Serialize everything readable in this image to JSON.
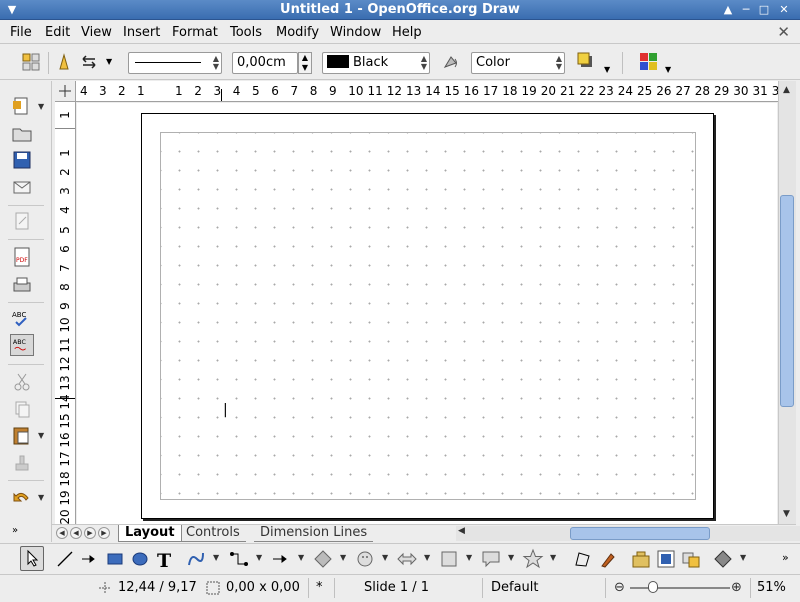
{
  "window": {
    "title": "Untitled 1 - OpenOffice.org Draw"
  },
  "menu": {
    "file": "File",
    "edit": "Edit",
    "view": "View",
    "insert": "Insert",
    "format": "Format",
    "tools": "Tools",
    "modify": "Modify",
    "window": "Window",
    "help": "Help"
  },
  "line_toolbar": {
    "line_width": "0,00cm",
    "line_color": "Black",
    "area_style": "Color"
  },
  "ruler": {
    "h_left": [
      "4",
      "3",
      "2",
      "1"
    ],
    "h_right": [
      "1",
      "2",
      "3",
      "4",
      "5",
      "6",
      "7",
      "8",
      "9",
      "10",
      "11",
      "12",
      "13",
      "14",
      "15",
      "16",
      "17",
      "18",
      "19",
      "20",
      "21",
      "22",
      "23",
      "24",
      "25",
      "26",
      "27",
      "28",
      "29",
      "30",
      "31",
      "3"
    ],
    "v_top": "1",
    "v_numbers": [
      "1",
      "2",
      "3",
      "4",
      "5",
      "6",
      "7",
      "8",
      "9",
      "10",
      "11",
      "12",
      "13",
      "14",
      "15",
      "16",
      "17",
      "18",
      "19",
      "20"
    ]
  },
  "tabs": {
    "layout": "Layout",
    "controls": "Controls",
    "dimension_lines": "Dimension Lines"
  },
  "status": {
    "position": "12,44 / 9,17",
    "size": "0,00 x 0,00",
    "modified": "*",
    "slide": "Slide 1 / 1",
    "layout": "Default",
    "zoom": "51%"
  },
  "colors": {
    "accent": "#3a6db0",
    "scroll_thumb": "#a8c4ea"
  }
}
